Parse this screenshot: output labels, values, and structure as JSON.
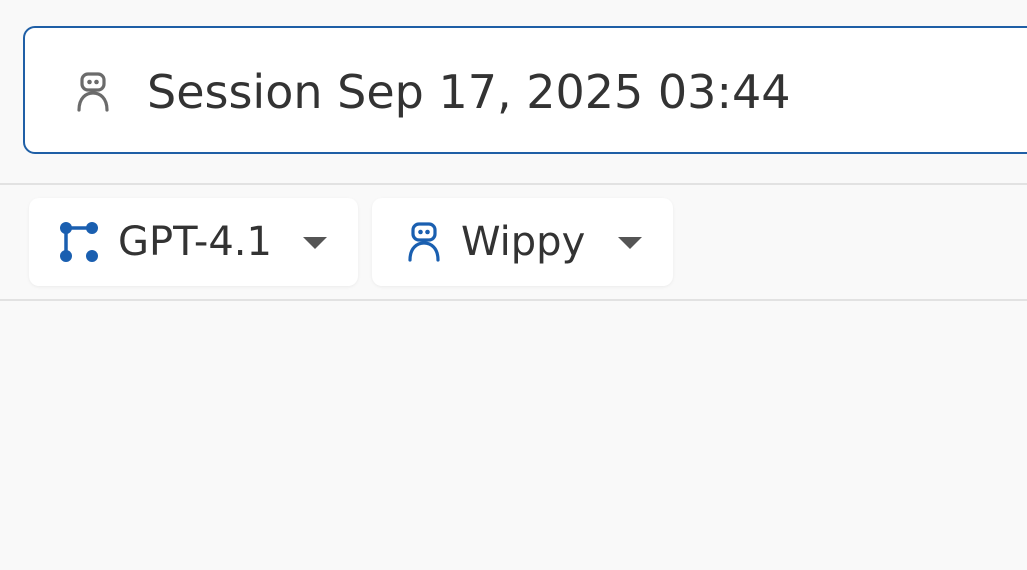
{
  "session": {
    "title": "Session Sep 17, 2025 03:44",
    "icon": "robot-icon"
  },
  "toolbar": {
    "model": {
      "label": "GPT-4.1",
      "icon": "model-graph-icon"
    },
    "agent": {
      "label": "Wippy",
      "icon": "robot-icon"
    }
  },
  "colors": {
    "accent": "#1f5fa6",
    "icon_blue": "#1a5fb0",
    "icon_gray": "#6b6b6b",
    "text": "#333333",
    "background": "#f9f9f9",
    "divider": "#e2e2e2"
  }
}
